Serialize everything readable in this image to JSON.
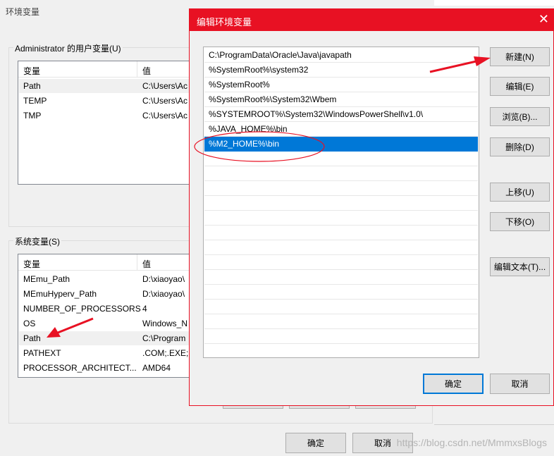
{
  "background_dialog": {
    "title": "环境变量",
    "user_vars": {
      "label": "Administrator 的用户变量(U)",
      "columns": [
        "变量",
        "值"
      ],
      "rows": [
        {
          "name": "Path",
          "value": "C:\\Users\\Ac"
        },
        {
          "name": "TEMP",
          "value": "C:\\Users\\Ac"
        },
        {
          "name": "TMP",
          "value": "C:\\Users\\Ac"
        }
      ]
    },
    "system_vars": {
      "label": "系统变量(S)",
      "columns": [
        "变量",
        "值"
      ],
      "rows": [
        {
          "name": "MEmu_Path",
          "value": "D:\\xiaoyao\\"
        },
        {
          "name": "MEmuHyperv_Path",
          "value": "D:\\xiaoyao\\"
        },
        {
          "name": "NUMBER_OF_PROCESSORS",
          "value": "4"
        },
        {
          "name": "OS",
          "value": "Windows_N"
        },
        {
          "name": "Path",
          "value": "C:\\Program"
        },
        {
          "name": "PATHEXT",
          "value": ".COM;.EXE;."
        },
        {
          "name": "PROCESSOR_ARCHITECT...",
          "value": "AMD64"
        }
      ]
    },
    "ok_label": "确定",
    "cancel_label": "取消"
  },
  "edit_dialog": {
    "title": "编辑环境变量",
    "close_glyph": "✕",
    "entries": [
      "C:\\ProgramData\\Oracle\\Java\\javapath",
      "%SystemRoot%\\system32",
      "%SystemRoot%",
      "%SystemRoot%\\System32\\Wbem",
      "%SYSTEMROOT%\\System32\\WindowsPowerShell\\v1.0\\",
      "%JAVA_HOME%\\bin",
      "%M2_HOME%\\bin"
    ],
    "selected_index": 6,
    "buttons": {
      "new": "新建(N)",
      "edit": "编辑(E)",
      "browse": "浏览(B)...",
      "delete": "删除(D)",
      "move_up": "上移(U)",
      "move_down": "下移(O)",
      "edit_text": "编辑文本(T)...",
      "ok": "确定",
      "cancel": "取消"
    }
  },
  "watermark": "https://blog.csdn.net/MmmxsBlogs",
  "colors": {
    "accent": "#0078d7",
    "annotation": "#e81123"
  }
}
